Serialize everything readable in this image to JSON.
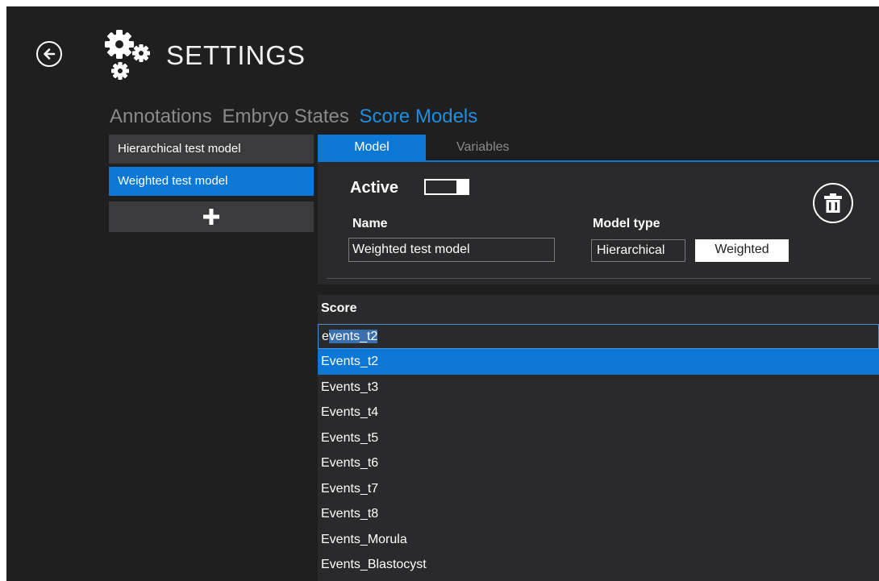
{
  "header": {
    "title": "SETTINGS"
  },
  "main_tabs": [
    {
      "label": "Annotations",
      "active": false
    },
    {
      "label": "Embryo States",
      "active": false
    },
    {
      "label": "Score Models",
      "active": true
    }
  ],
  "models": [
    {
      "label": "Hierarchical test model",
      "selected": false
    },
    {
      "label": "Weighted test model",
      "selected": true
    }
  ],
  "sub_tabs": {
    "model": "Model",
    "variables": "Variables"
  },
  "model_panel": {
    "active_label": "Active",
    "active_on": true,
    "name_label": "Name",
    "name_value": "Weighted test model",
    "type_label": "Model type",
    "type_options": [
      "Hierarchical",
      "Weighted"
    ],
    "type_selected": "Weighted"
  },
  "score": {
    "label": "Score",
    "input_prefix": "e",
    "input_selected": "vents_t2",
    "options": [
      "Events_t2",
      "Events_t3",
      "Events_t4",
      "Events_t5",
      "Events_t6",
      "Events_t7",
      "Events_t8",
      "Events_Morula",
      "Events_Blastocyst"
    ],
    "highlighted_index": 0
  },
  "icons": {
    "back": "back-arrow-circle-icon",
    "settings": "gears-icon",
    "add": "plus-icon",
    "delete": "trash-icon"
  },
  "colors": {
    "accent": "#0a78d4",
    "background": "#1f1f1f",
    "panel": "#2a2a2c"
  }
}
